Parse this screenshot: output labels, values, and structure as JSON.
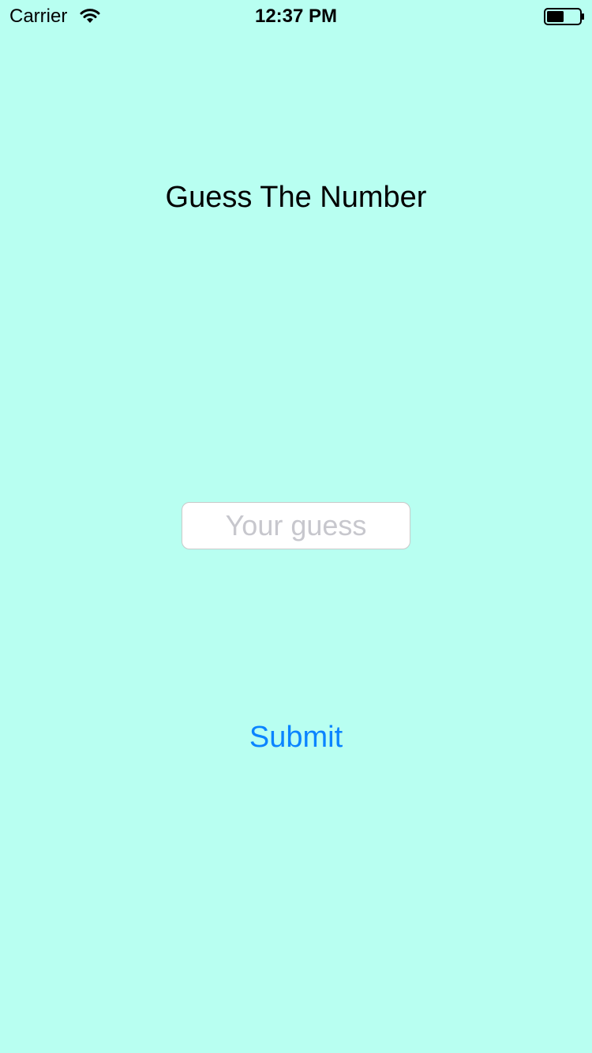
{
  "status_bar": {
    "carrier": "Carrier",
    "time": "12:37 PM",
    "wifi_icon": "wifi-icon",
    "battery_icon": "battery-icon"
  },
  "main": {
    "title": "Guess The Number",
    "guess_input": {
      "value": "",
      "placeholder": "Your guess"
    },
    "submit_label": "Submit"
  },
  "colors": {
    "background": "#b8fff1",
    "accent": "#0a84ff",
    "placeholder": "#c7c7cd"
  }
}
